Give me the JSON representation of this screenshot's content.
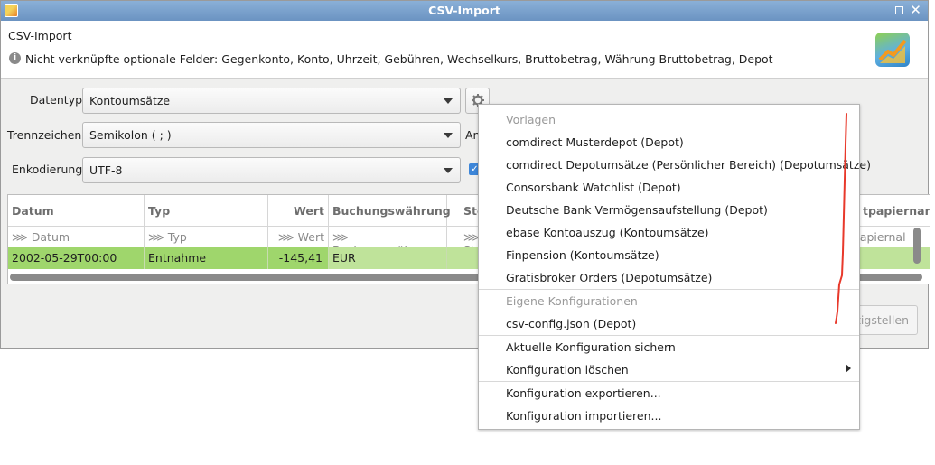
{
  "window": {
    "title": "CSV-Import"
  },
  "header": {
    "title": "CSV-Import",
    "info": "Nicht verknüpfte optionale Felder: Gegenkonto, Konto, Uhrzeit, Gebühren, Wechselkurs, Bruttobetrag, Währung Bruttobetrag, Depot"
  },
  "form": {
    "datentyp": {
      "label": "Datentyp:",
      "value": "Kontoumsätze"
    },
    "trennzeichen": {
      "label": "Trennzeichen:",
      "value": "Semikolon ( ; )"
    },
    "enkodierung": {
      "label": "Enkodierung:",
      "value": "UTF-8"
    },
    "clipped_label": "An",
    "checkbox_checked": true
  },
  "table": {
    "columns": [
      "Datum",
      "Typ",
      "Wert",
      "Buchungswährung",
      "Ste",
      "tpapiernam"
    ],
    "mapped": [
      "⋙ Datum",
      "⋙ Typ",
      "⋙ Wert",
      "⋙ Buchungswährung",
      "⋙ Ste",
      "tpapiernal"
    ],
    "rows": [
      [
        "2002-05-29T00:00",
        "Entnahme",
        "-145,41",
        "EUR",
        "",
        ""
      ]
    ]
  },
  "buttons": {
    "reset": "tigstellen"
  },
  "menu": {
    "templates_header": "Vorlagen",
    "templates": [
      "comdirect Musterdepot (Depot)",
      "comdirect Depotumsätze (Persönlicher Bereich) (Depotumsätze)",
      "Consorsbank Watchlist (Depot)",
      "Deutsche Bank Vermögensaufstellung (Depot)",
      "ebase Kontoauszug (Kontoumsätze)",
      "Finpension (Kontoumsätze)",
      "Gratisbroker Orders (Depotumsätze)"
    ],
    "own_header": "Eigene Konfigurationen",
    "own": [
      "csv-config.json (Depot)"
    ],
    "save": "Aktuelle Konfiguration sichern",
    "delete": "Konfiguration löschen",
    "export": "Konfiguration exportieren...",
    "import": "Konfiguration importieren..."
  },
  "colors": {
    "row_bg": "#bfe39a",
    "row_selected": "#9fd66c",
    "titlebar": "#7aa3cf",
    "annotation": "#e8392b"
  }
}
